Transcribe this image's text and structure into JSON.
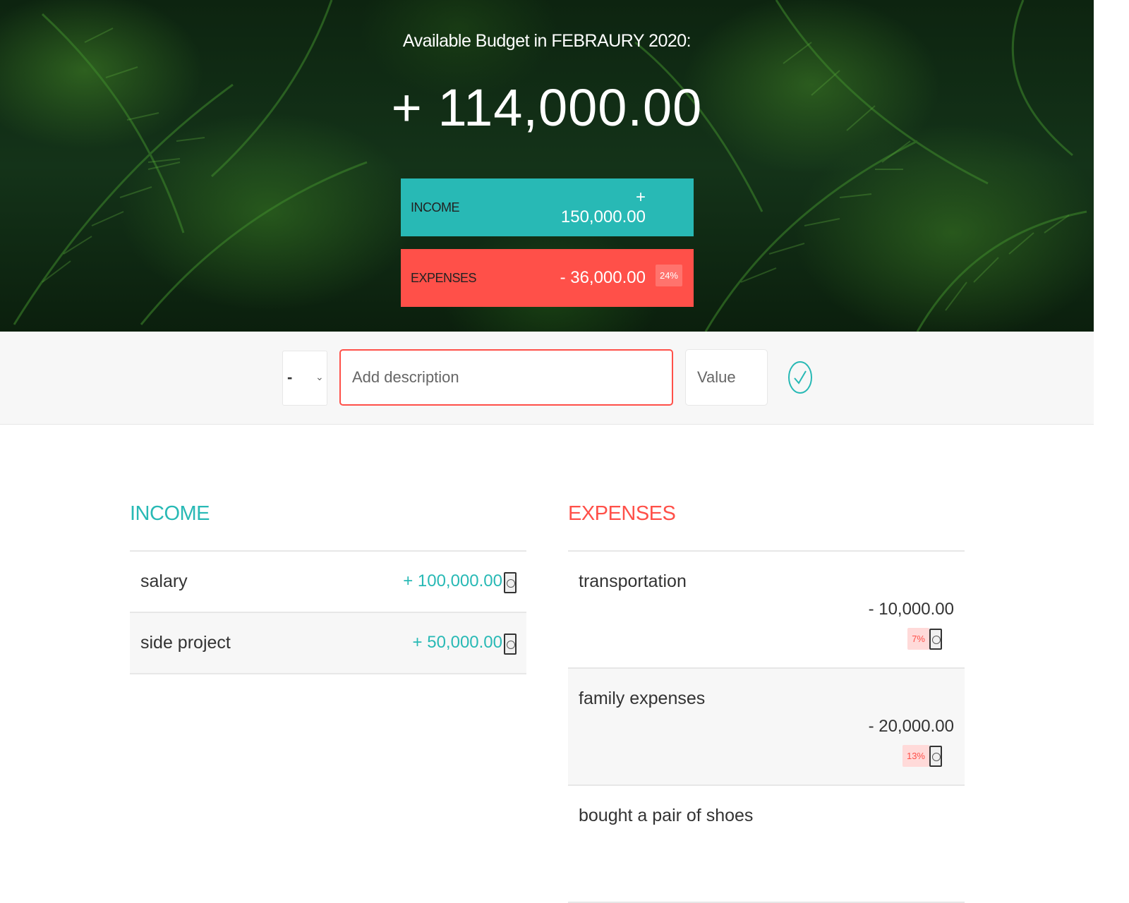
{
  "header": {
    "title": "Available Budget in FEBRAURY 2020:",
    "budget": "+ 114,000.00",
    "income": {
      "label": "INCOME",
      "value": "+ 150,000.00"
    },
    "expenses": {
      "label": "EXPENSES",
      "value": "- 36,000.00",
      "percentage": "24%"
    }
  },
  "add": {
    "type_symbol": "-",
    "description_placeholder": "Add description",
    "value_placeholder": "Value"
  },
  "income": {
    "title": "INCOME",
    "items": [
      {
        "description": "salary",
        "value": "+ 100,000.00"
      },
      {
        "description": "side project",
        "value": "+ 50,000.00"
      }
    ]
  },
  "expenses": {
    "title": "EXPENSES",
    "items": [
      {
        "description": "transportation",
        "value": "- 10,000.00",
        "percentage": "7%"
      },
      {
        "description": "family expenses",
        "value": "- 20,000.00",
        "percentage": "13%"
      },
      {
        "description": "bought a pair of shoes"
      }
    ]
  },
  "colors": {
    "income": "#28b9b5",
    "expenses": "#ff5049"
  },
  "icons": {
    "delete": "close-circle-icon",
    "submit": "checkmark-circle-icon",
    "select": "chevron-down-icon"
  }
}
